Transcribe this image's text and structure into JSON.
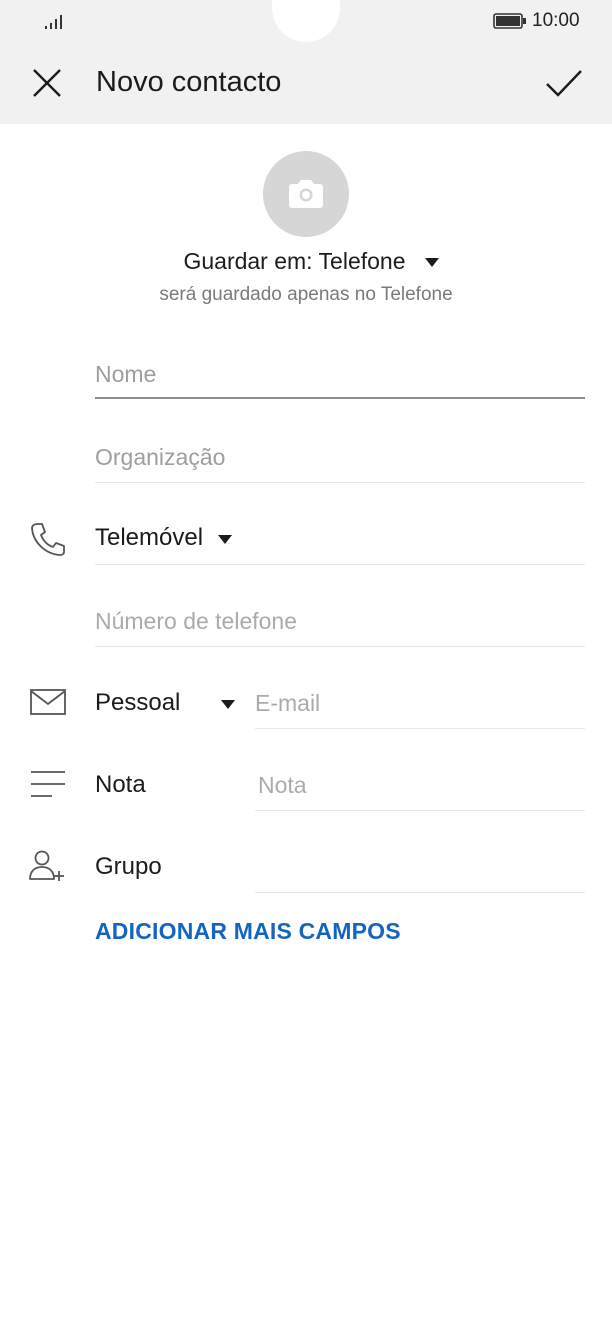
{
  "status_bar": {
    "time": "10:00"
  },
  "header": {
    "title": "Novo contacto"
  },
  "storage": {
    "label": "Guardar em: Telefone",
    "note": "será guardado apenas no Telefone"
  },
  "fields": {
    "name_placeholder": "Nome",
    "organization_placeholder": "Organização",
    "phone_type": "Telemóvel",
    "phone_placeholder": "Número de telefone",
    "email_type": "Pessoal",
    "email_placeholder": "E-mail",
    "note_label": "Nota",
    "note_placeholder": "Nota",
    "group_label": "Grupo"
  },
  "actions": {
    "add_more": "ADICIONAR MAIS CAMPOS"
  },
  "colors": {
    "accent": "#1565c0",
    "header_bg": "#f1f1f1",
    "avatar_bg": "#d6d6d6"
  }
}
